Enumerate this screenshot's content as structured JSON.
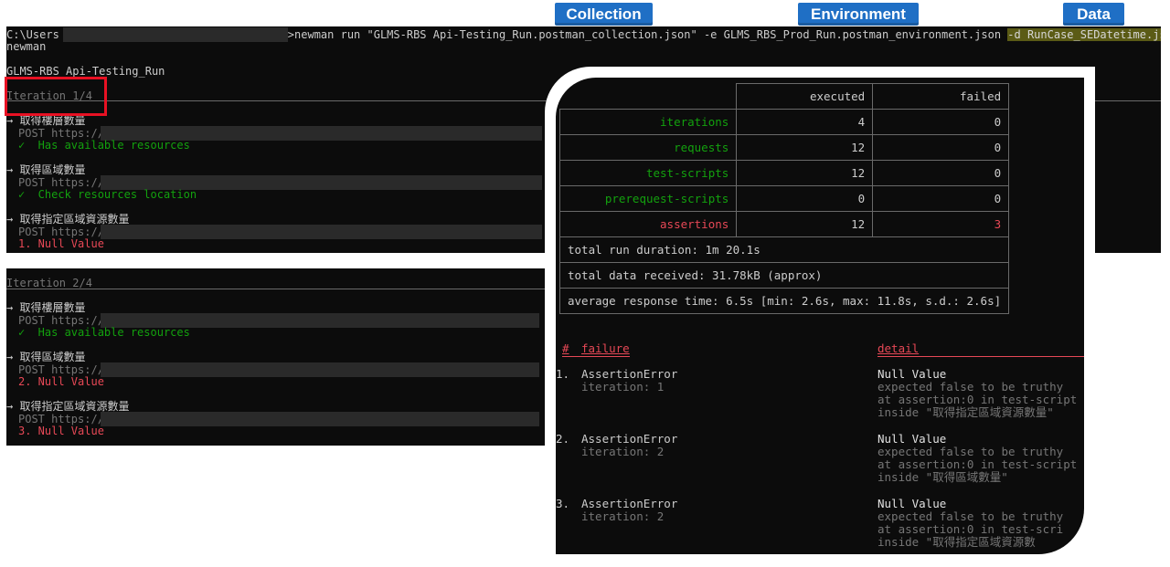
{
  "tags": {
    "collection": "Collection",
    "environment": "Environment",
    "data": "Data"
  },
  "top_terminal": {
    "prompt_prefix": "C:\\Users",
    "command": ">newman run \"GLMS-RBS Api-Testing_Run.postman_collection.json\" -e GLMS_RBS_Prod_Run.postman_environment.json ",
    "data_flag": "-d RunCase_SEDatetime.json",
    "command_wrap": "newman",
    "collection_name": "GLMS-RBS Api-Testing_Run",
    "iteration": "Iteration 1/4",
    "requests": [
      {
        "name": "→ 取得樓層數量",
        "method": "POST https://",
        "result": "✓  Has available resources",
        "status": "pass"
      },
      {
        "name": "→ 取得區域數量",
        "method": "POST https://",
        "result": "✓  Check resources location",
        "status": "pass"
      },
      {
        "name": "→ 取得指定區域資源數量",
        "method": "POST https://",
        "result": "1. Null Value",
        "status": "fail"
      }
    ]
  },
  "bottom_terminal": {
    "iteration": "Iteration 2/4",
    "requests": [
      {
        "name": "→ 取得樓層數量",
        "method": "POST https://",
        "result": "✓  Has available resources",
        "status": "pass"
      },
      {
        "name": "→ 取得區域數量",
        "method": "POST https://",
        "result": "2. Null Value",
        "status": "fail"
      },
      {
        "name": "→ 取得指定區域資源數量",
        "method": "POST https://",
        "result": "3. Null Value",
        "status": "fail"
      }
    ]
  },
  "summary": {
    "headers": {
      "executed": "executed",
      "failed": "failed"
    },
    "rows": [
      {
        "label": "iterations",
        "executed": "4",
        "failed": "0",
        "color": "#13a10e"
      },
      {
        "label": "requests",
        "executed": "12",
        "failed": "0",
        "color": "#13a10e"
      },
      {
        "label": "test-scripts",
        "executed": "12",
        "failed": "0",
        "color": "#13a10e"
      },
      {
        "label": "prerequest-scripts",
        "executed": "0",
        "failed": "0",
        "color": "#13a10e"
      },
      {
        "label": "assertions",
        "executed": "12",
        "failed": "3",
        "color": "#e74856"
      }
    ],
    "duration": "total run duration: 1m 20.1s",
    "data_received": "total data received: 31.78kB (approx)",
    "avg_response": "average response time: 6.5s [min: 2.6s, max: 11.8s, s.d.: 2.6s]"
  },
  "failures": {
    "col_num": "#",
    "col_failure": "failure",
    "col_detail": "detail",
    "items": [
      {
        "num": "1.",
        "error": "AssertionError",
        "iteration": "iteration: 1",
        "title": "Null Value",
        "line1": "expected false to be truthy",
        "line2": "at assertion:0 in test-script",
        "line3": "inside \"取得指定區域資源數量\""
      },
      {
        "num": "2.",
        "error": "AssertionError",
        "iteration": "iteration: 2",
        "title": "Null Value",
        "line1": "expected false to be truthy",
        "line2": "at assertion:0 in test-script",
        "line3": "inside \"取得區域數量\""
      },
      {
        "num": "3.",
        "error": "AssertionError",
        "iteration": "iteration: 2",
        "title": "Null Value",
        "line1": "expected false to be truthy",
        "line2": "at assertion:0 in test-scri",
        "line3": "inside \"取得指定區域資源數"
      }
    ]
  }
}
